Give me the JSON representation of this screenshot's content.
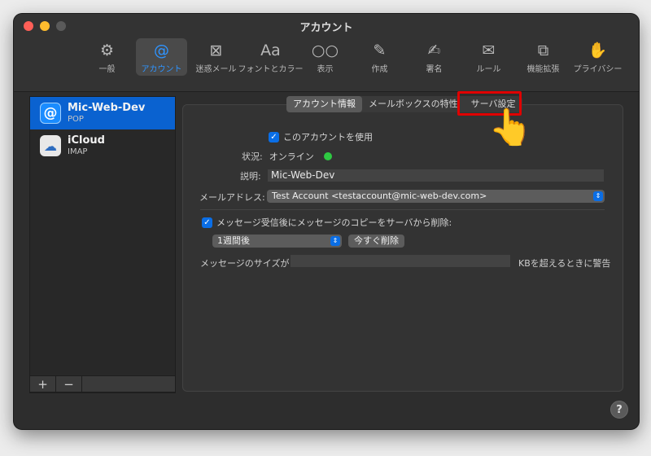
{
  "window": {
    "title": "アカウント"
  },
  "toolbar": {
    "items": [
      {
        "label": "一般",
        "icon": "⚙"
      },
      {
        "label": "アカウント",
        "icon": "@"
      },
      {
        "label": "迷惑メール",
        "icon": "⊠"
      },
      {
        "label": "フォントとカラー",
        "icon": "Aa"
      },
      {
        "label": "表示",
        "icon": "○○"
      },
      {
        "label": "作成",
        "icon": "✎"
      },
      {
        "label": "署名",
        "icon": "✍"
      },
      {
        "label": "ルール",
        "icon": "✉"
      },
      {
        "label": "機能拡張",
        "icon": "⧉"
      },
      {
        "label": "プライバシー",
        "icon": "✋"
      }
    ],
    "active_index": 1
  },
  "sidebar": {
    "accounts": [
      {
        "name": "Mic-Web-Dev",
        "type": "POP",
        "icon": "@"
      },
      {
        "name": "iCloud",
        "type": "IMAP",
        "icon": "☁"
      }
    ],
    "add_label": "+",
    "remove_label": "−"
  },
  "tabs": [
    {
      "label": "アカウント情報"
    },
    {
      "label": "メールボックスの特性"
    },
    {
      "label": "サーバ設定"
    }
  ],
  "form": {
    "enable_label": "このアカウントを使用",
    "status_label": "状況:",
    "status_value": "オンライン",
    "description_label": "説明:",
    "description_value": "Mic-Web-Dev",
    "email_label": "メールアドレス:",
    "email_value": "Test Account <testaccount@mic-web-dev.com>",
    "delete_label": "メッセージ受信後にメッセージのコピーをサーバから削除:",
    "delete_period": "1週間後",
    "delete_now_button": "今すぐ削除",
    "size_label_pre": "メッセージのサイズが",
    "size_value": "",
    "size_label_post": "KBを超えるときに警告"
  },
  "help": {
    "label": "?"
  },
  "colors": {
    "accent": "#0a62d0",
    "highlight": "#e00000",
    "status_online": "#2ec942"
  },
  "icons": {
    "traffic": [
      "close-button",
      "minimize-button",
      "zoom-button"
    ],
    "pointer": "pointing-hand-icon"
  }
}
